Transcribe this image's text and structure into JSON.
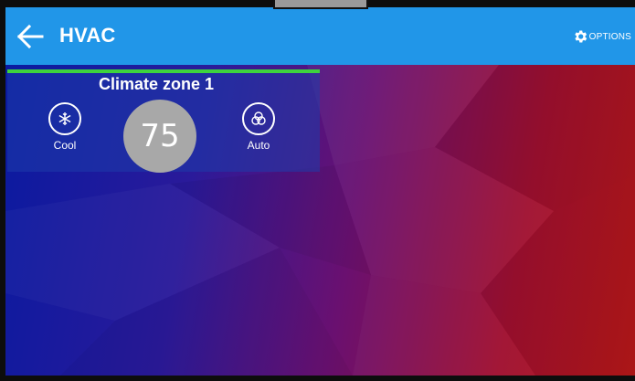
{
  "header": {
    "title": "HVAC",
    "options_label": "OPTIONS",
    "back_icon": "arrow-left-icon",
    "options_icon": "gear-icon",
    "color": "#2196e8"
  },
  "zone": {
    "name": "Climate zone 1",
    "status_color": "#3ed33e",
    "setpoint": "75",
    "mode": {
      "label": "Cool",
      "icon": "snowflake-icon"
    },
    "fan": {
      "label": "Auto",
      "icon": "fan-auto-icon"
    }
  }
}
